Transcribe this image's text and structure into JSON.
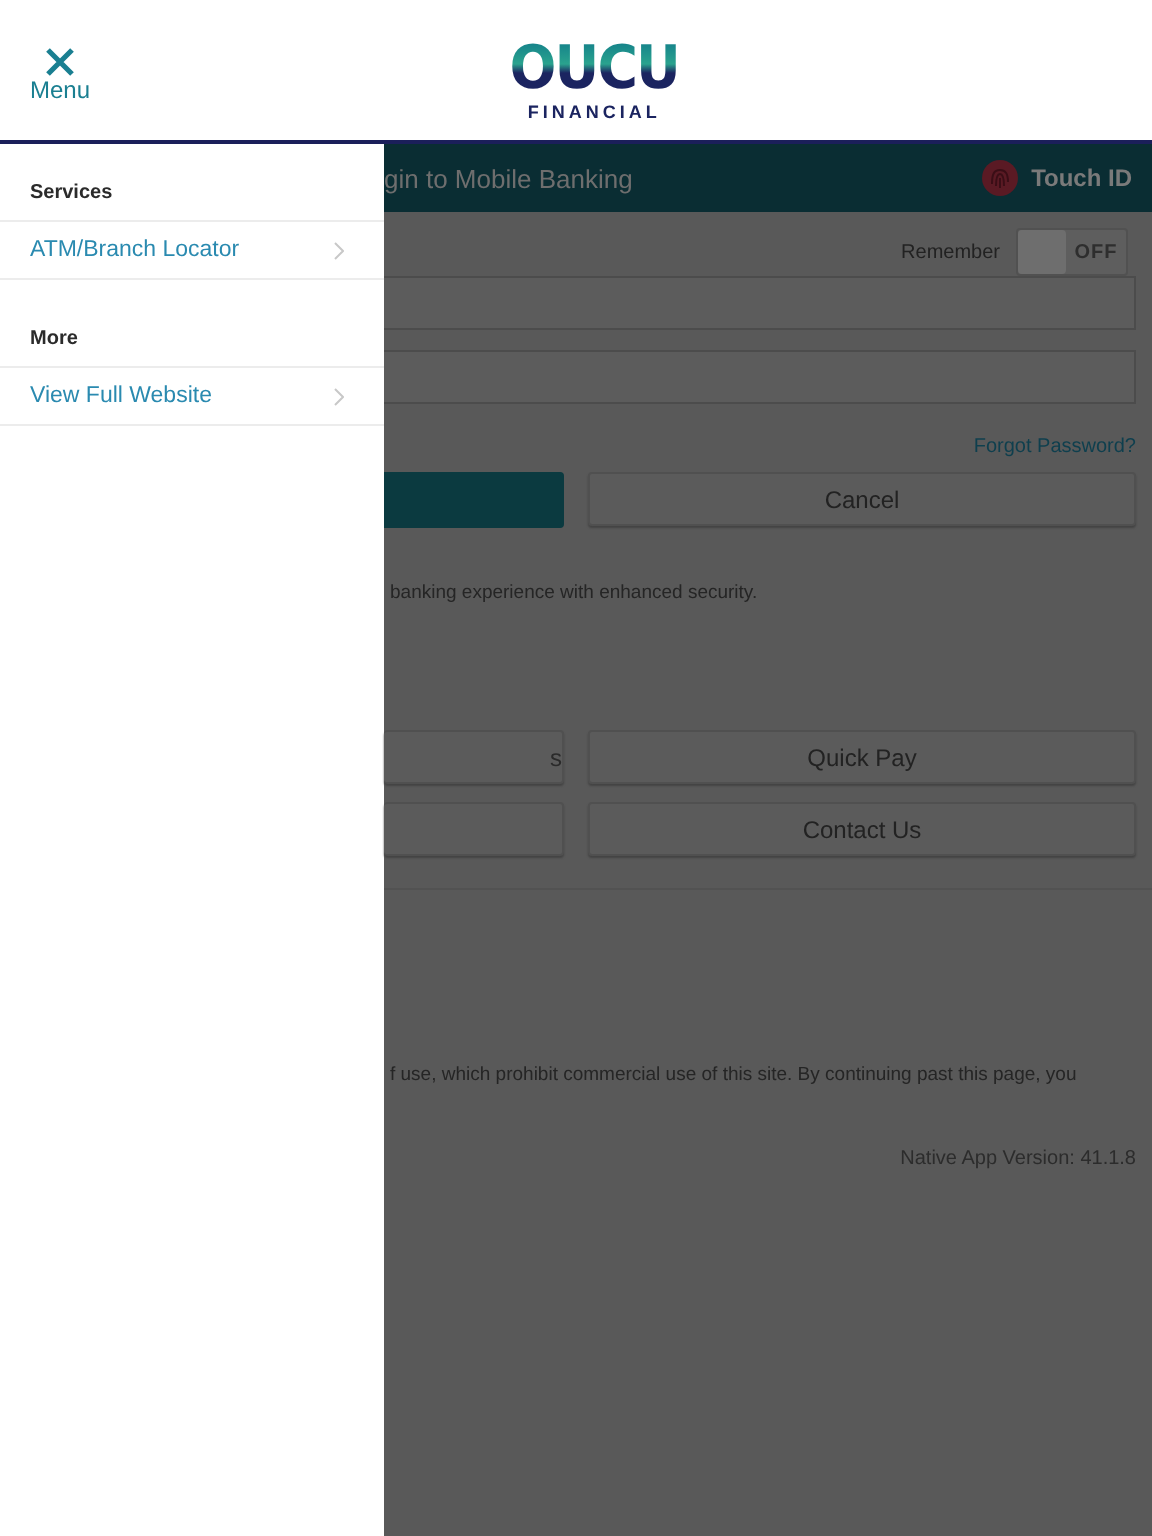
{
  "header": {
    "close_label": "Menu",
    "logo": {
      "wordmark": "OUCU",
      "tagline": "FINANCIAL"
    }
  },
  "drawer": {
    "sections": [
      {
        "heading": "Services",
        "items": [
          {
            "label": "ATM/Branch Locator"
          }
        ]
      },
      {
        "heading": "More",
        "items": [
          {
            "label": "View Full Website"
          }
        ]
      }
    ]
  },
  "login": {
    "title": "gin to Mobile Banking",
    "touch_id": "Touch ID",
    "remember": {
      "label": "Remember",
      "on": false,
      "state_text": "OFF"
    },
    "forgot": "Forgot Password?",
    "cancel": "Cancel",
    "note": "banking experience with enhanced security.",
    "quick_rows": [
      {
        "left_label": "s",
        "right_label": "Quick Pay"
      },
      {
        "right_label": "Contact Us"
      }
    ],
    "terms": "f use, which prohibit commercial use of this site. By continuing past this page, you",
    "version": "Native App Version: 41.1.8"
  }
}
